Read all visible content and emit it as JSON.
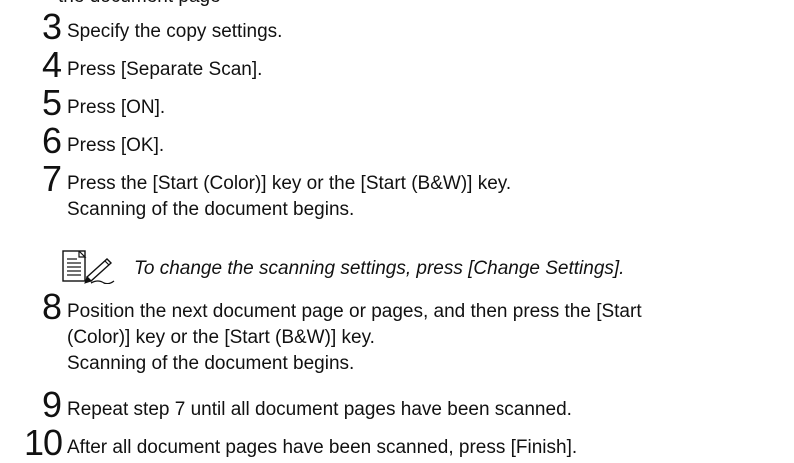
{
  "top_fragment": "the document page",
  "steps": [
    {
      "number": "3",
      "lines": [
        "Specify the copy settings."
      ]
    },
    {
      "number": "4",
      "lines": [
        "Press [Separate Scan]."
      ]
    },
    {
      "number": "5",
      "lines": [
        "Press [ON]."
      ]
    },
    {
      "number": "6",
      "lines": [
        "Press [OK]."
      ]
    },
    {
      "number": "7",
      "lines": [
        "Press the [Start (Color)] key or the [Start (B&W)] key.",
        "Scanning of the document begins."
      ]
    },
    {
      "number": "8",
      "lines": [
        "Position the next document page or pages, and then press the [Start",
        "(Color)] key or the [Start (B&W)] key.",
        "Scanning of the document begins."
      ]
    },
    {
      "number": "9",
      "lines": [
        "Repeat step 7 until all document pages have been scanned."
      ]
    },
    {
      "number": "10",
      "lines": [
        "After all document pages have been scanned, press [Finish]."
      ]
    }
  ],
  "note": {
    "icon": "note-pencil-icon",
    "text": "To change the scanning settings, press [Change Settings]."
  }
}
